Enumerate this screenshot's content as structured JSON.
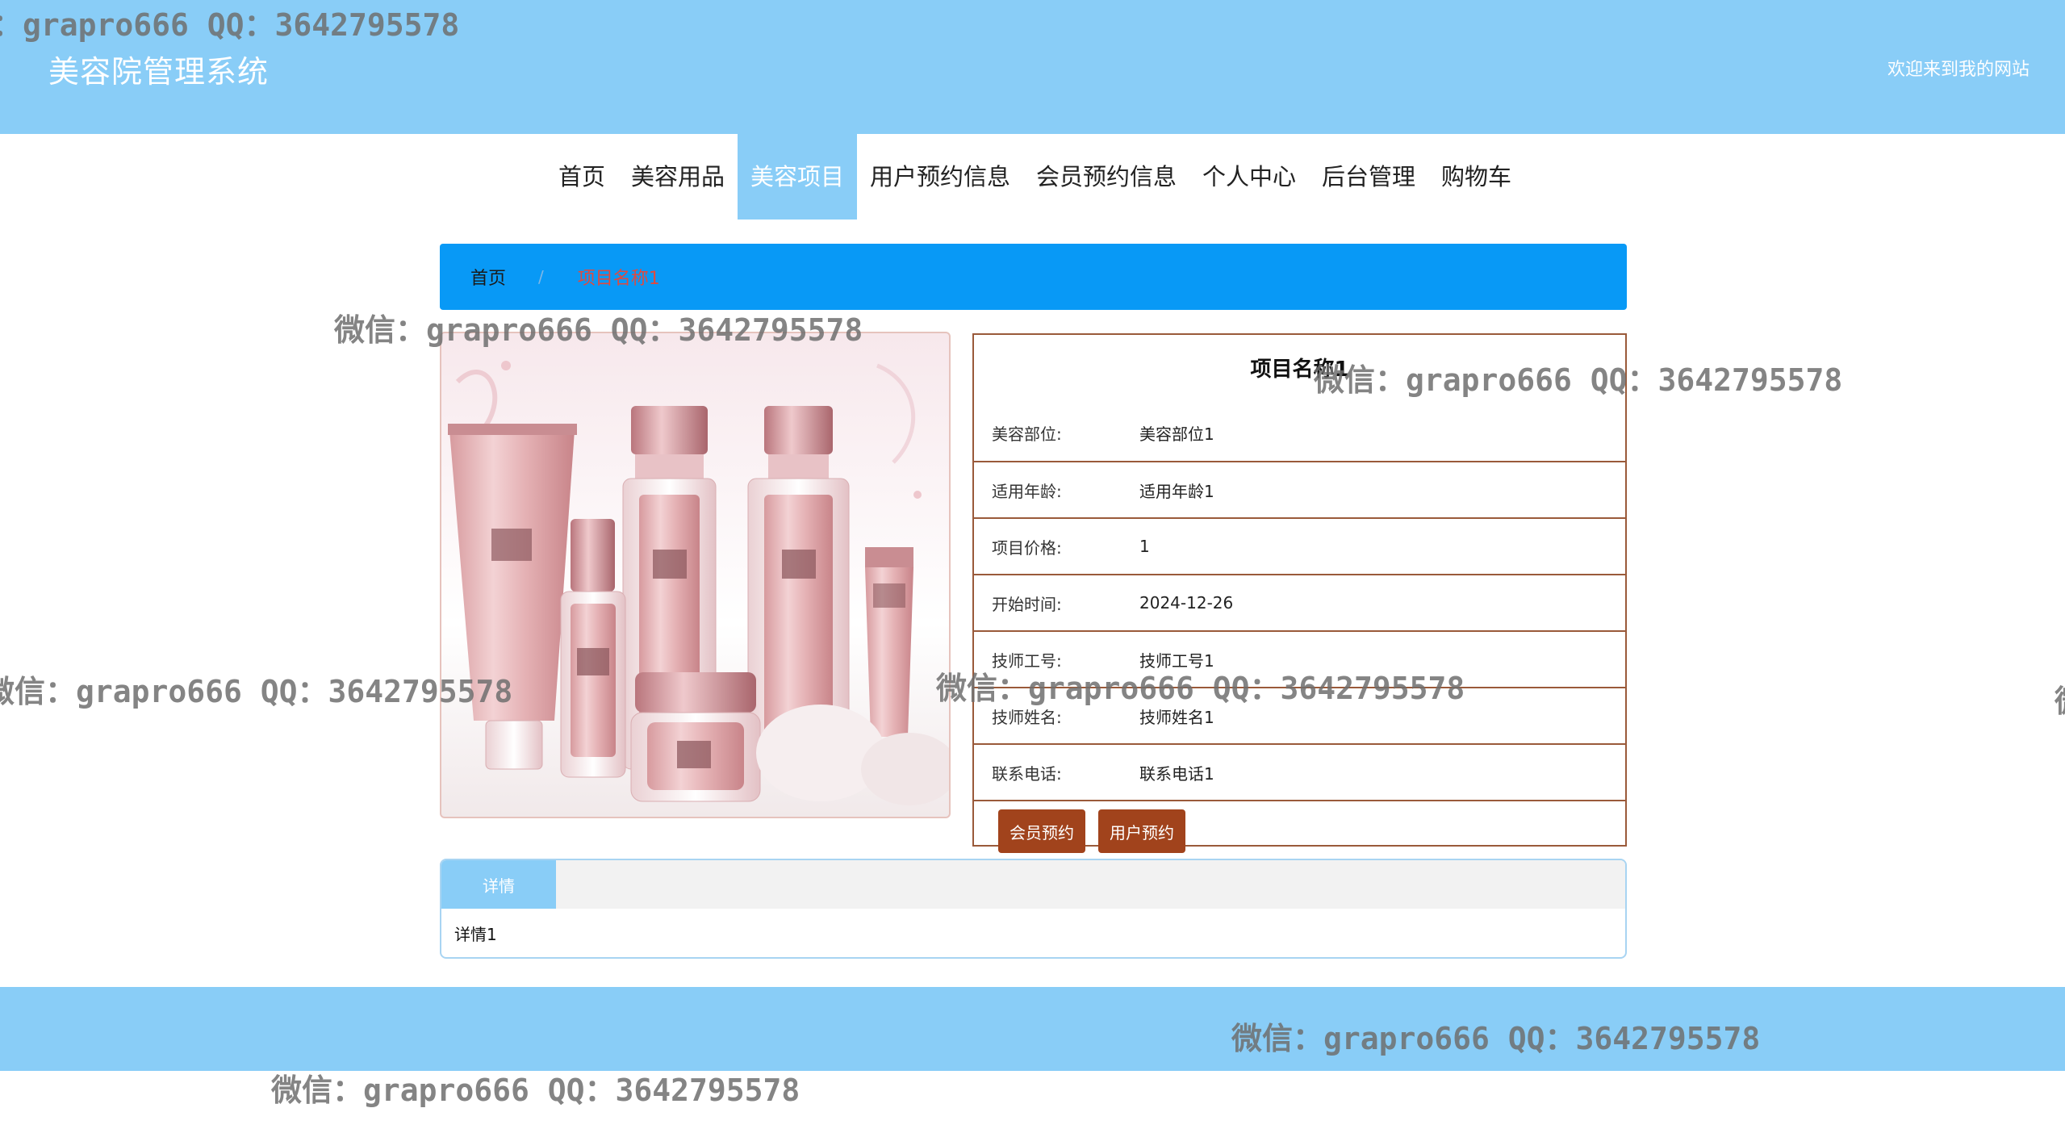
{
  "header": {
    "title": "美容院管理系统",
    "welcome": "欢迎来到我的网站"
  },
  "nav": {
    "items": [
      {
        "label": "首页"
      },
      {
        "label": "美容用品"
      },
      {
        "label": "美容项目",
        "active": true
      },
      {
        "label": "用户预约信息"
      },
      {
        "label": "会员预约信息"
      },
      {
        "label": "个人中心"
      },
      {
        "label": "后台管理"
      },
      {
        "label": "购物车"
      }
    ]
  },
  "breadcrumb": {
    "home": "首页",
    "separator": "/",
    "current": "项目名称1"
  },
  "product": {
    "image_description": "pink cosmetic bottles and jars set",
    "title": "项目名称1",
    "fields": [
      {
        "label": "美容部位:",
        "value": "美容部位1"
      },
      {
        "label": "适用年龄:",
        "value": "适用年龄1"
      },
      {
        "label": "项目价格:",
        "value": "1"
      },
      {
        "label": "开始时间:",
        "value": "2024-12-26"
      },
      {
        "label": "技师工号:",
        "value": "技师工号1"
      },
      {
        "label": "技师姓名:",
        "value": "技师姓名1"
      },
      {
        "label": "联系电话:",
        "value": "联系电话1"
      }
    ],
    "actions": {
      "member_booking": "会员预约",
      "user_booking": "用户预约"
    }
  },
  "tabs": {
    "items": [
      {
        "label": "详情"
      }
    ],
    "content": "详情1"
  },
  "watermarks": [
    "：grapro666 QQ：3642795578",
    "微信：grapro666 QQ：3642795578",
    "微信：grapro666 QQ：3642795578",
    "微信：grapro666 QQ：3642795578",
    "微信：grapro666 QQ：3642795578",
    "微信：grapro666 QQ：3642795578",
    "微信：grapro666 QQ：3642795578",
    "微"
  ],
  "colors": {
    "header_bg": "#89cdf7",
    "breadcrumb_bg": "#0899f6",
    "button_bg": "#a1431c",
    "table_border": "#9a5a3a",
    "crumb_current": "#e04a3f"
  }
}
